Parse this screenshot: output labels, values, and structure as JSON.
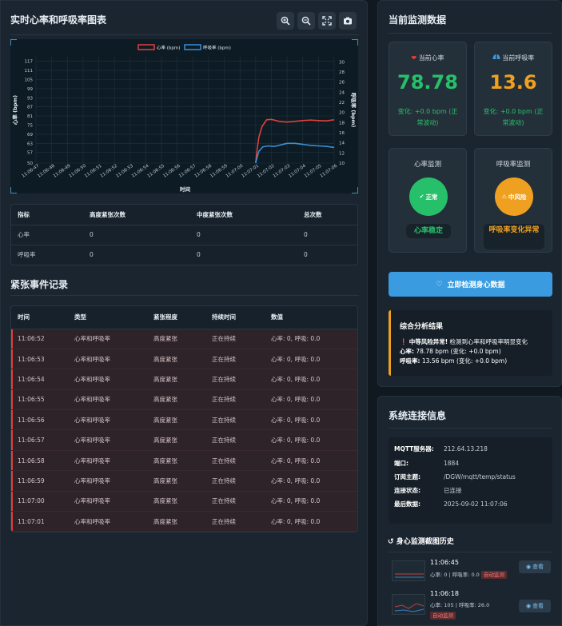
{
  "chart_panel": {
    "title": "实时心率和呼吸率图表",
    "toolbar": [
      "zoom-in-icon",
      "zoom-out-icon",
      "fullscreen-icon",
      "camera-icon"
    ]
  },
  "chart_data": {
    "type": "line",
    "x": [
      "11:06:47",
      "11:06:48",
      "11:06:49",
      "11:06:50",
      "11:06:51",
      "11:06:52",
      "11:06:53",
      "11:06:54",
      "11:06:55",
      "11:06:56",
      "11:06:57",
      "11:06:58",
      "11:06:59",
      "11:07:00",
      "11:07:01",
      "11:07:02",
      "11:07:03",
      "11:07:04",
      "11:07:05",
      "11:07:06"
    ],
    "xlabel": "时间",
    "ylabel_left": "心率 (bpm)",
    "ylabel_right": "呼吸率 (bpm)",
    "yticks_left": [
      50,
      57,
      63,
      69,
      75,
      81,
      87,
      93,
      99,
      105,
      111,
      117
    ],
    "yticks_right": [
      10,
      12,
      14,
      16,
      18,
      20,
      22,
      24,
      26,
      28,
      30
    ],
    "ylim_left": [
      50,
      120
    ],
    "ylim_right": [
      10,
      31
    ],
    "series": [
      {
        "name": "心率 (bpm)",
        "color": "#e0413d",
        "axis": "left",
        "points": [
          [
            14.0,
            50
          ],
          [
            14.08,
            58
          ],
          [
            14.2,
            67
          ],
          [
            14.4,
            74
          ],
          [
            14.7,
            78.5
          ],
          [
            15.0,
            78.8
          ],
          [
            15.5,
            77.5
          ],
          [
            16.0,
            77
          ],
          [
            16.5,
            77.5
          ],
          [
            17.0,
            78
          ],
          [
            17.5,
            78.3
          ],
          [
            18.0,
            78
          ],
          [
            18.5,
            77.8
          ],
          [
            19.0,
            78.5
          ]
        ]
      },
      {
        "name": "呼吸率 (bpm)",
        "color": "#3a8fd8",
        "axis": "right",
        "points": [
          [
            14.0,
            10
          ],
          [
            14.08,
            11
          ],
          [
            14.2,
            12.3
          ],
          [
            14.45,
            13.2
          ],
          [
            14.8,
            13.4
          ],
          [
            15.2,
            13.3
          ],
          [
            15.6,
            13.6
          ],
          [
            16.0,
            13.9
          ],
          [
            16.5,
            13.9
          ],
          [
            17.0,
            13.7
          ],
          [
            17.5,
            13.5
          ],
          [
            18.0,
            13.4
          ],
          [
            18.5,
            13.3
          ],
          [
            19.0,
            13.1
          ]
        ]
      }
    ]
  },
  "stats": {
    "headers": [
      "指标",
      "高度紧张次数",
      "中度紧张次数",
      "总次数"
    ],
    "rows": [
      [
        "心率",
        "0",
        "0",
        "0"
      ],
      [
        "呼吸率",
        "0",
        "0",
        "0"
      ]
    ]
  },
  "events": {
    "title": "紧张事件记录",
    "headers": [
      "时间",
      "类型",
      "紧张程度",
      "持续时间",
      "数值"
    ],
    "rows": [
      [
        "11:06:52",
        "心率和呼吸率",
        "高度紧张",
        "正在持续",
        "心率: 0, 呼吸: 0.0"
      ],
      [
        "11:06:53",
        "心率和呼吸率",
        "高度紧张",
        "正在持续",
        "心率: 0, 呼吸: 0.0"
      ],
      [
        "11:06:54",
        "心率和呼吸率",
        "高度紧张",
        "正在持续",
        "心率: 0, 呼吸: 0.0"
      ],
      [
        "11:06:55",
        "心率和呼吸率",
        "高度紧张",
        "正在持续",
        "心率: 0, 呼吸: 0.0"
      ],
      [
        "11:06:56",
        "心率和呼吸率",
        "高度紧张",
        "正在持续",
        "心率: 0, 呼吸: 0.0"
      ],
      [
        "11:06:57",
        "心率和呼吸率",
        "高度紧张",
        "正在持续",
        "心率: 0, 呼吸: 0.0"
      ],
      [
        "11:06:58",
        "心率和呼吸率",
        "高度紧张",
        "正在持续",
        "心率: 0, 呼吸: 0.0"
      ],
      [
        "11:06:59",
        "心率和呼吸率",
        "高度紧张",
        "正在持续",
        "心率: 0, 呼吸: 0.0"
      ],
      [
        "11:07:00",
        "心率和呼吸率",
        "高度紧张",
        "正在持续",
        "心率: 0, 呼吸: 0.0"
      ],
      [
        "11:07:01",
        "心率和呼吸率",
        "高度紧张",
        "正在持续",
        "心率: 0, 呼吸: 0.0"
      ]
    ]
  },
  "monitor": {
    "title": "当前监测数据",
    "hr_label": "当前心率",
    "hr_value": "78.78",
    "hr_change": "变化: +0.0 bpm (正常波动)",
    "rr_label": "当前呼吸率",
    "rr_value": "13.6",
    "rr_change": "变化: +0.0 bpm (正常波动)",
    "hr_monitor_label": "心率监测",
    "hr_status": "正常",
    "hr_status_text": "心率稳定",
    "rr_monitor_label": "呼吸率监测",
    "rr_status": "中风险",
    "rr_status_text": "呼吸率变化异常",
    "detect_button": "立即检测身心数据",
    "analysis_title": "综合分析结果",
    "analysis_alert": "中等风险异常!",
    "analysis_msg": "检测到心率和呼吸率明显变化",
    "analysis_hr_label": "心率:",
    "analysis_hr": "78.78 bpm (变化: +0.0 bpm)",
    "analysis_rr_label": "呼吸率:",
    "analysis_rr": "13.56 bpm (变化: +0.0 bpm)",
    "colors": {
      "green": "#27c06a",
      "orange": "#f0a020",
      "blue": "#3a9be0",
      "red": "#e0413d"
    }
  },
  "connection": {
    "title": "系统连接信息",
    "rows": [
      {
        "k": "MQTT服务器:",
        "v": "212.64.13.218"
      },
      {
        "k": "端口:",
        "v": "1884"
      },
      {
        "k": "订阅主题:",
        "v": "/DGW/mqtt/temp/status"
      },
      {
        "k": "连接状态:",
        "v": "已连接"
      },
      {
        "k": "最后数据:",
        "v": "2025-09-02 11:07:06"
      }
    ],
    "history_title": "身心监测截图历史",
    "history": [
      {
        "time": "11:06:45",
        "detail": "心率: 0 | 呼吸率: 0.0",
        "tag": "自动监测",
        "view": "查看"
      },
      {
        "time": "11:06:18",
        "detail": "心率: 105 | 呼吸率: 26.0",
        "tag": "自动监测",
        "view": "查看"
      }
    ]
  }
}
